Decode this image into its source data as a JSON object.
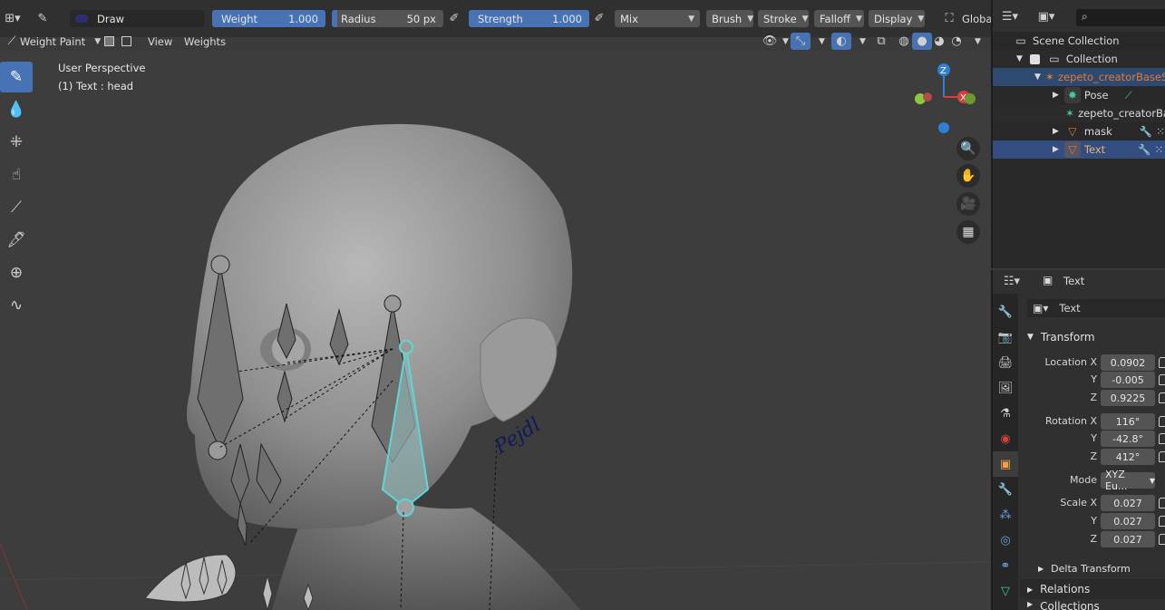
{
  "header": {
    "brush_name": "Draw",
    "weight": {
      "label": "Weight",
      "value": "1.000"
    },
    "radius": {
      "label": "Radius",
      "value": "50 px"
    },
    "strength": {
      "label": "Strength",
      "value": "1.000"
    },
    "blend_mode": "Mix",
    "menus": [
      "Brush",
      "Stroke",
      "Falloff",
      "Display"
    ],
    "orientation": "Globa",
    "mode": "Weight Paint",
    "view_menu": "View",
    "weights_menu": "Weights"
  },
  "viewport": {
    "perspective": "User Perspective",
    "active_info": "(1) Text : head",
    "gizmo_axes": [
      "Z",
      "X"
    ],
    "text_on_mesh": "Pejdl"
  },
  "outliner": {
    "rows": [
      {
        "label": "Scene Collection",
        "icon": "scene-collection-icon"
      },
      {
        "label": "Collection",
        "icon": "collection-icon"
      },
      {
        "label": "zepeto_creatorBaseSe",
        "icon": "armature-icon"
      },
      {
        "label": "Pose",
        "icon": "pose-icon"
      },
      {
        "label": "zepeto_creatorBa",
        "icon": "armature-data-icon"
      },
      {
        "label": "mask",
        "icon": "mesh-icon"
      },
      {
        "label": "Text",
        "icon": "mesh-icon"
      }
    ]
  },
  "properties": {
    "header_title": "Text",
    "object_name": "Text",
    "transform_section": "Transform",
    "location": {
      "label": "Location X",
      "x": "0.0902",
      "y": "-0.005",
      "z": "0.9225"
    },
    "rotation": {
      "label": "Rotation X",
      "x": "116°",
      "y": "-42.8°",
      "z": "412°"
    },
    "mode": {
      "label": "Mode",
      "value": "XYZ Eu..."
    },
    "scale": {
      "label": "Scale X",
      "x": "0.027",
      "y": "0.027",
      "z": "0.027"
    },
    "axis_labels": {
      "y": "Y",
      "z": "Z"
    },
    "delta_transform": "Delta Transform",
    "relations": "Relations",
    "collections": "Collections"
  },
  "colors": {
    "accent": "#4772b3",
    "selection": "#334d80",
    "bone_highlight": "#5fd6d6",
    "object_orange": "#e07a3a"
  }
}
